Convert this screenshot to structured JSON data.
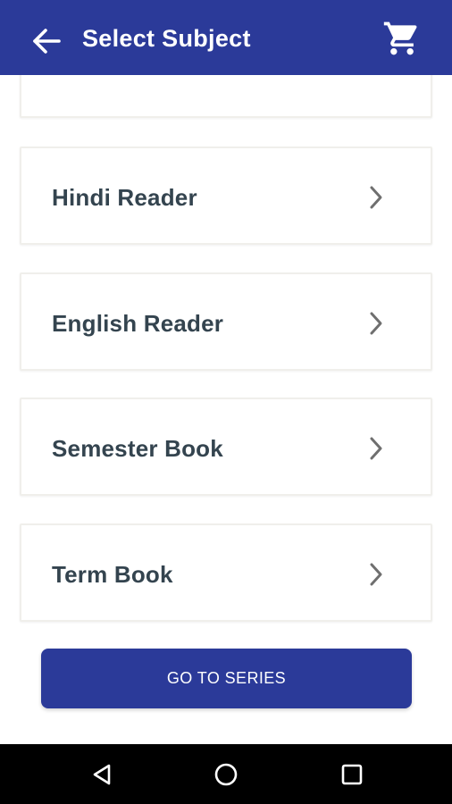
{
  "app_bar": {
    "title": "Select Subject",
    "back_icon": "arrow-back-icon",
    "cart_icon": "shopping-cart-icon"
  },
  "subjects": [
    {
      "label": "Hindi Reader"
    },
    {
      "label": "English Reader"
    },
    {
      "label": "Semester Book"
    },
    {
      "label": "Term Book"
    }
  ],
  "go_button": {
    "label": "GO TO SERIES"
  },
  "nav_bar": {
    "back_icon": "nav-back-icon",
    "home_icon": "nav-home-icon",
    "recents_icon": "nav-recents-icon"
  },
  "colors": {
    "primary": "#2b3a99",
    "text": "#34444f",
    "chevron": "#6f6f6f"
  }
}
